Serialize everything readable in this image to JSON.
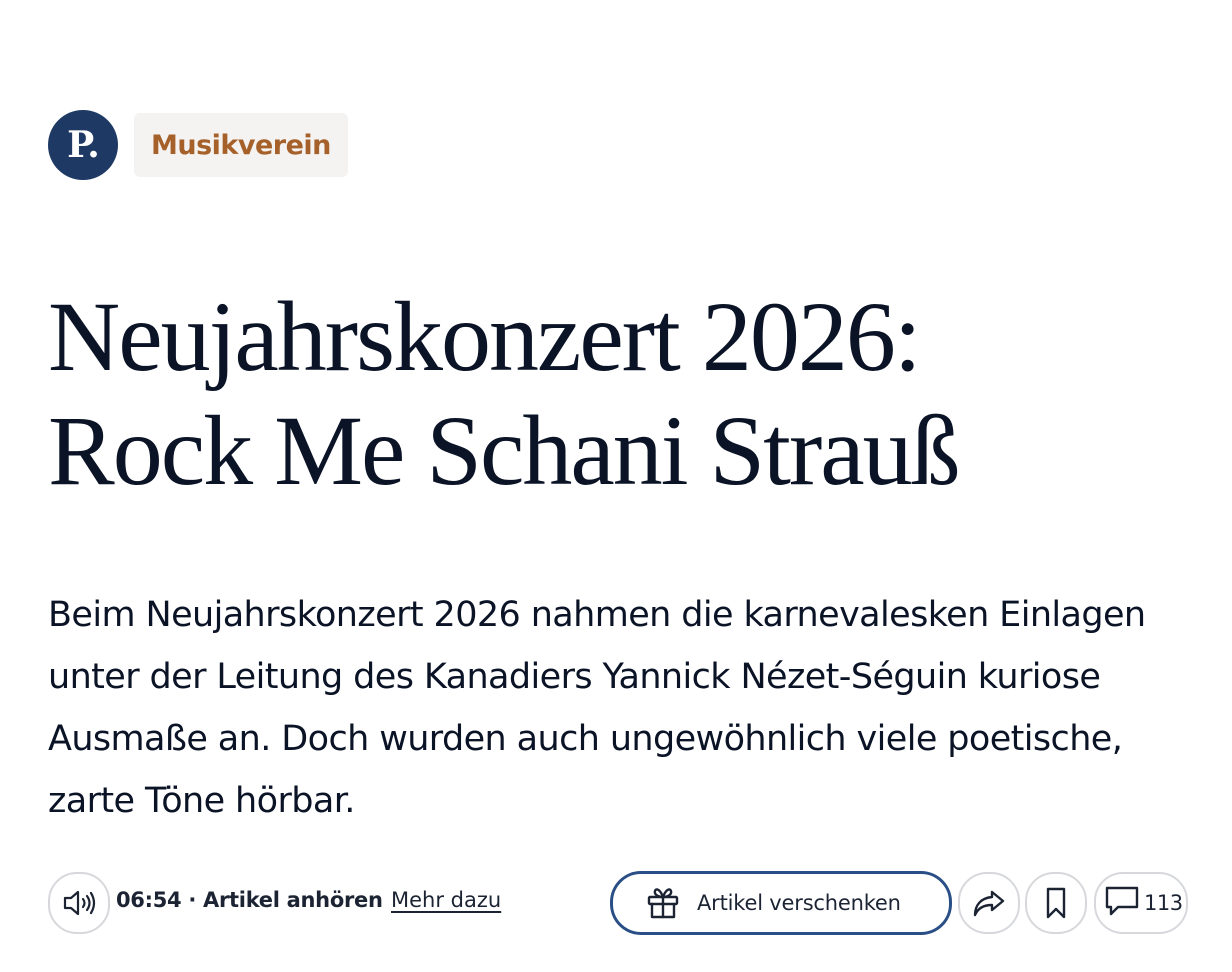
{
  "brand": {
    "logo_text": "P.",
    "logo_color": "#1e3a64"
  },
  "category": {
    "label": "Musikverein",
    "color": "#a6612a"
  },
  "article": {
    "headline_line1": "Neujahrskonzert 2026:",
    "headline_line2": "Rock Me Schani Strauß",
    "lead": "Beim Neujahrskonzert 2026 nahmen die karnevalesken Einlagen unter der Leitung des Kanadiers Yannick Nézet-Séguin kuriose Ausmaße an. Doch wurden auch ungewöhnlich viele poetische, zarte Töne hörbar."
  },
  "toolbar": {
    "audio_icon": "speaker-icon",
    "audio_text": "06:54 · Artikel anhören",
    "more_link": "Mehr dazu",
    "gift_icon": "gift-icon",
    "gift_label": "Artikel verschenken",
    "share_icon": "share-icon",
    "bookmark_icon": "bookmark-icon",
    "comment_icon": "comment-icon",
    "comment_count": "113",
    "accent_color": "#2a4f86"
  }
}
